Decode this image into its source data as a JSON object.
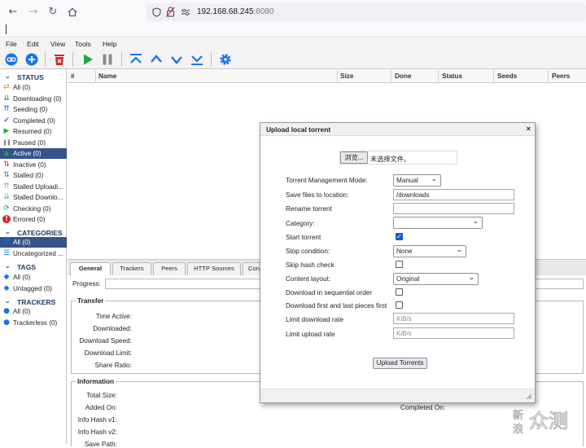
{
  "browser": {
    "url_host": "192.168.68.245",
    "url_port": ":8080"
  },
  "menu": [
    "File",
    "Edit",
    "View",
    "Tools",
    "Help"
  ],
  "sidebar": {
    "status_title": "STATUS",
    "status_items": [
      {
        "label": "All (0)",
        "icon": "shuffle-icon"
      },
      {
        "label": "Downloading (0)",
        "icon": "download-arrow-icon"
      },
      {
        "label": "Seeding (0)",
        "icon": "upload-arrow-icon"
      },
      {
        "label": "Completed (0)",
        "icon": "check-icon"
      },
      {
        "label": "Resumed (0)",
        "icon": "play-icon"
      },
      {
        "label": "Paused (0)",
        "icon": "pause-icon"
      },
      {
        "label": "Active (0)",
        "icon": "filter-icon"
      },
      {
        "label": "Inactive (0)",
        "icon": "inactive-arrows-icon"
      },
      {
        "label": "Stalled (0)",
        "icon": "stalled-arrows-icon"
      },
      {
        "label": "Stalled Uploadi...",
        "icon": "stalled-upload-icon"
      },
      {
        "label": "Stalled Downlo...",
        "icon": "stalled-download-icon"
      },
      {
        "label": "Checking (0)",
        "icon": "refresh-icon"
      },
      {
        "label": "Errored (0)",
        "icon": "error-icon"
      }
    ],
    "categories_title": "CATEGORIES",
    "categories_items": [
      {
        "label": "All (0)",
        "icon": "list-icon"
      },
      {
        "label": "Uncategorized ...",
        "icon": "list-icon"
      }
    ],
    "tags_title": "TAGS",
    "tags_items": [
      {
        "label": "All (0)",
        "icon": "tag-icon"
      },
      {
        "label": "Untagged (0)",
        "icon": "tag-icon"
      }
    ],
    "trackers_title": "TRACKERS",
    "trackers_items": [
      {
        "label": "All (0)",
        "icon": "pin-icon"
      },
      {
        "label": "Trackerless (0)",
        "icon": "pin-icon"
      }
    ],
    "colors": {
      "accent": "#35528a",
      "status_title": "#1e3a66"
    }
  },
  "table": {
    "columns": [
      "#",
      "Name",
      "Size",
      "Done",
      "Status",
      "Seeds",
      "Peers"
    ]
  },
  "details": {
    "tabs": [
      "General",
      "Trackers",
      "Peers",
      "HTTP Sources",
      "Con"
    ],
    "progress_label": "Progress:",
    "transfer_title": "Transfer",
    "transfer_labels": [
      "Time Active:",
      "Downloaded:",
      "Download Speed:",
      "Download Limit:",
      "Share Ratio:"
    ],
    "information_title": "Information",
    "information_labels": [
      "Total Size:",
      "Added On:",
      "Info Hash v1:",
      "Info Hash v2:",
      "Save Path:"
    ],
    "completed_on_label": "Completed On:"
  },
  "dialog": {
    "title": "Upload local torrent",
    "close": "×",
    "browse_button": "浏览...",
    "no_file": "未选择文件。",
    "fields": {
      "tmm_label": "Torrent Management Mode:",
      "tmm_value": "Manual",
      "save_label": "Save files to location:",
      "save_value": "/downloads",
      "rename_label": "Rename torrent",
      "category_label": "Category:",
      "category_value": "",
      "start_label": "Start torrent",
      "start_checked": true,
      "stop_label": "Stop condition:",
      "stop_value": "None",
      "skip_label": "Skip hash check",
      "skip_checked": false,
      "layout_label": "Content layout:",
      "layout_value": "Original",
      "sequential_label": "Download in sequential order",
      "sequential_checked": false,
      "firstlast_label": "Download first and last pieces first",
      "firstlast_checked": false,
      "dl_limit_label": "Limit download rate",
      "dl_limit_placeholder": "KiB/s",
      "ul_limit_label": "Limit upload rate",
      "ul_limit_placeholder": "KiB/s"
    },
    "upload_button": "Upload Torrents"
  },
  "watermark": "新浪众测"
}
